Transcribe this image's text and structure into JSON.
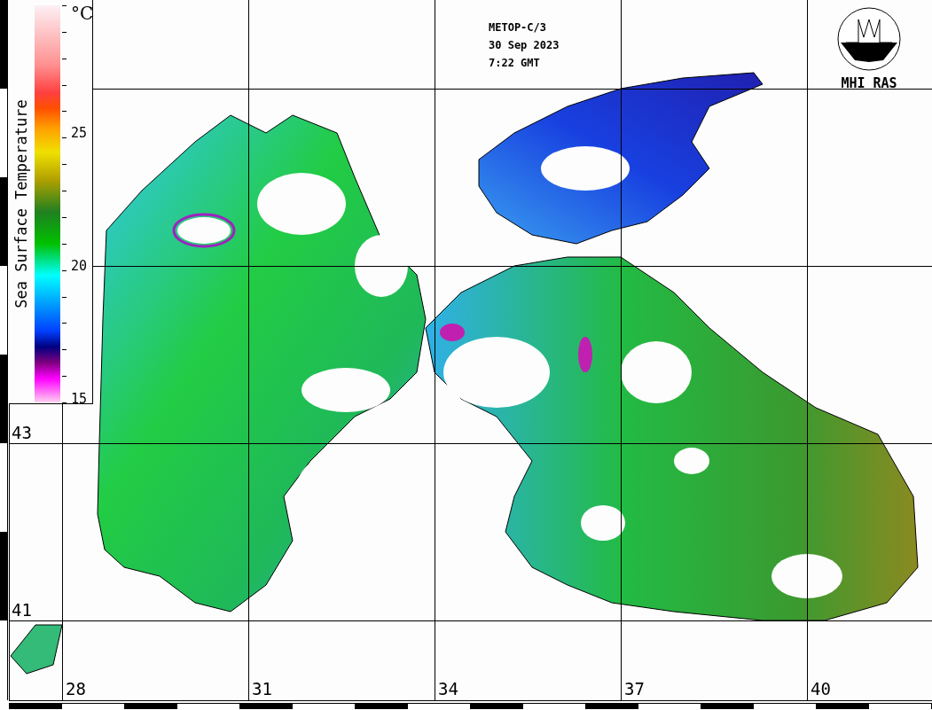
{
  "satellite": {
    "name": "METOP-C/3",
    "date": "30 Sep 2023",
    "time": "7:22 GMT"
  },
  "logo": {
    "label": "MHI RAS"
  },
  "color_scale": {
    "title": "Sea Surface Temperature",
    "unit": "°C",
    "ticks": [
      "25",
      "20",
      "15"
    ]
  },
  "latitude_labels": [
    "43",
    "41"
  ],
  "longitude_labels": [
    "28",
    "31",
    "34",
    "37",
    "40"
  ]
}
